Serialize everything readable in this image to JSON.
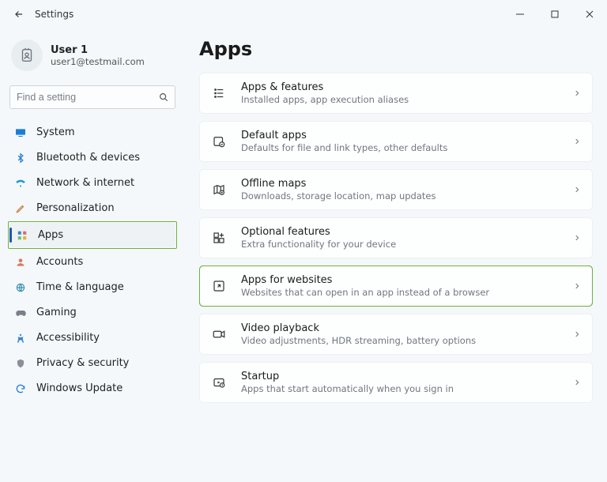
{
  "window": {
    "title": "Settings"
  },
  "user": {
    "name": "User 1",
    "email": "user1@testmail.com"
  },
  "search": {
    "placeholder": "Find a setting"
  },
  "sidebar": {
    "items": [
      {
        "label": "System"
      },
      {
        "label": "Bluetooth & devices"
      },
      {
        "label": "Network & internet"
      },
      {
        "label": "Personalization"
      },
      {
        "label": "Apps"
      },
      {
        "label": "Accounts"
      },
      {
        "label": "Time & language"
      },
      {
        "label": "Gaming"
      },
      {
        "label": "Accessibility"
      },
      {
        "label": "Privacy & security"
      },
      {
        "label": "Windows Update"
      }
    ]
  },
  "page": {
    "title": "Apps"
  },
  "cards": [
    {
      "title": "Apps & features",
      "subtitle": "Installed apps, app execution aliases"
    },
    {
      "title": "Default apps",
      "subtitle": "Defaults for file and link types, other defaults"
    },
    {
      "title": "Offline maps",
      "subtitle": "Downloads, storage location, map updates"
    },
    {
      "title": "Optional features",
      "subtitle": "Extra functionality for your device"
    },
    {
      "title": "Apps for websites",
      "subtitle": "Websites that can open in an app instead of a browser"
    },
    {
      "title": "Video playback",
      "subtitle": "Video adjustments, HDR streaming, battery options"
    },
    {
      "title": "Startup",
      "subtitle": "Apps that start automatically when you sign in"
    }
  ]
}
